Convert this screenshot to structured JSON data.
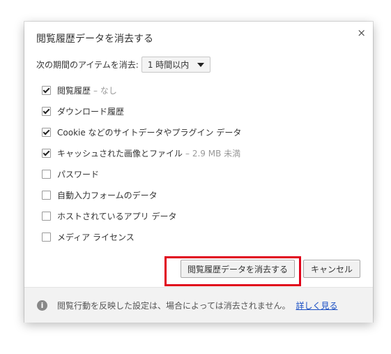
{
  "dialog": {
    "title": "閲覧履歴データを消去する",
    "close_glyph": "×"
  },
  "range": {
    "label": "次の期間のアイテムを消去:",
    "selected": "1 時間以内"
  },
  "options": [
    {
      "label": "閲覧履歴",
      "sub": "– なし",
      "checked": true
    },
    {
      "label": "ダウンロード履歴",
      "sub": "",
      "checked": true
    },
    {
      "label": "Cookie などのサイトデータやプラグイン データ",
      "sub": "",
      "checked": true
    },
    {
      "label": "キャッシュされた画像とファイル",
      "sub": "– 2.9 MB 未満",
      "checked": true
    },
    {
      "label": "パスワード",
      "sub": "",
      "checked": false
    },
    {
      "label": "自動入力フォームのデータ",
      "sub": "",
      "checked": false
    },
    {
      "label": "ホストされているアプリ データ",
      "sub": "",
      "checked": false
    },
    {
      "label": "メディア ライセンス",
      "sub": "",
      "checked": false
    }
  ],
  "buttons": {
    "clear": "閲覧履歴データを消去する",
    "cancel": "キャンセル"
  },
  "footer": {
    "info_glyph": "i",
    "text": "閲覧行動を反映した設定は、場合によっては消去されません。",
    "link": "詳しく見る"
  },
  "colors": {
    "highlight": "#e0001a",
    "link": "#1a4fc4"
  }
}
